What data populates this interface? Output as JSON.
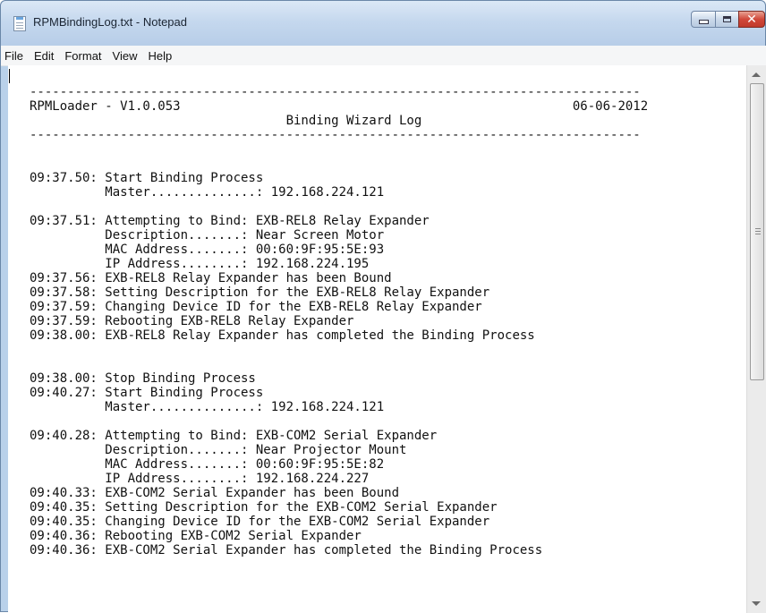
{
  "window": {
    "title": "RPMBindingLog.txt - Notepad",
    "app_icon": "notepad-icon",
    "caption_buttons": [
      "minimize-icon",
      "maximize-icon",
      "close-icon"
    ]
  },
  "menu": [
    "File",
    "Edit",
    "Format",
    "View",
    "Help"
  ],
  "document": {
    "content": "---------------------------------------------------------------------------------\nRPMLoader - V1.0.053                                                    06-06-2012\n                                  Binding Wizard Log\n---------------------------------------------------------------------------------\n\n\n09:37.50: Start Binding Process\n          Master..............: 192.168.224.121\n\n09:37.51: Attempting to Bind: EXB-REL8 Relay Expander\n          Description.......: Near Screen Motor\n          MAC Address.......: 00:60:9F:95:5E:93\n          IP Address........: 192.168.224.195\n09:37.56: EXB-REL8 Relay Expander has been Bound\n09:37.58: Setting Description for the EXB-REL8 Relay Expander\n09:37.59: Changing Device ID for the EXB-REL8 Relay Expander\n09:37.59: Rebooting EXB-REL8 Relay Expander\n09:38.00: EXB-REL8 Relay Expander has completed the Binding Process\n\n\n09:38.00: Stop Binding Process\n09:40.27: Start Binding Process\n          Master..............: 192.168.224.121\n\n09:40.28: Attempting to Bind: EXB-COM2 Serial Expander\n          Description.......: Near Projector Mount\n          MAC Address.......: 00:60:9F:95:5E:82\n          IP Address........: 192.168.224.227\n09:40.33: EXB-COM2 Serial Expander has been Bound\n09:40.35: Setting Description for the EXB-COM2 Serial Expander\n09:40.35: Changing Device ID for the EXB-COM2 Serial Expander\n09:40.36: Rebooting EXB-COM2 Serial Expander\n09:40.36: EXB-COM2 Serial Expander has completed the Binding Process"
  }
}
